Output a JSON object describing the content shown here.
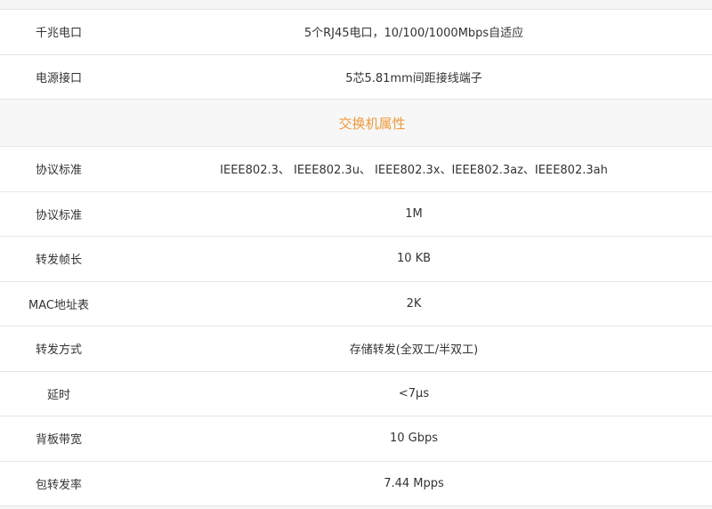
{
  "specs": {
    "row0": {
      "label": "千兆电口",
      "value": "5个RJ45电口，10/100/1000Mbps自适应"
    },
    "row1": {
      "label": "电源接口",
      "value": "5芯5.81mm间距接线端子"
    },
    "section": {
      "title": "交换机属性"
    },
    "row2": {
      "label": "协议标准",
      "value": "IEEE802.3、 IEEE802.3u、 IEEE802.3x、IEEE802.3az、IEEE802.3ah"
    },
    "row3": {
      "label": "协议标准",
      "value": "1M"
    },
    "row4": {
      "label": "转发帧长",
      "value": "10 KB"
    },
    "row5": {
      "label": "MAC地址表",
      "value": "2K"
    },
    "row6": {
      "label": "转发方式",
      "value": "存储转发(全双工/半双工)"
    },
    "row7": {
      "label": "延时",
      "value": "<7μs"
    },
    "row8": {
      "label": "背板带宽",
      "value": "10 Gbps"
    },
    "row9": {
      "label": "包转发率",
      "value": "7.44 Mpps"
    }
  },
  "colors": {
    "section_title": "#f39a3c",
    "text": "#333333",
    "border": "#e6e6e6",
    "section_bg": "#f7f7f7"
  }
}
